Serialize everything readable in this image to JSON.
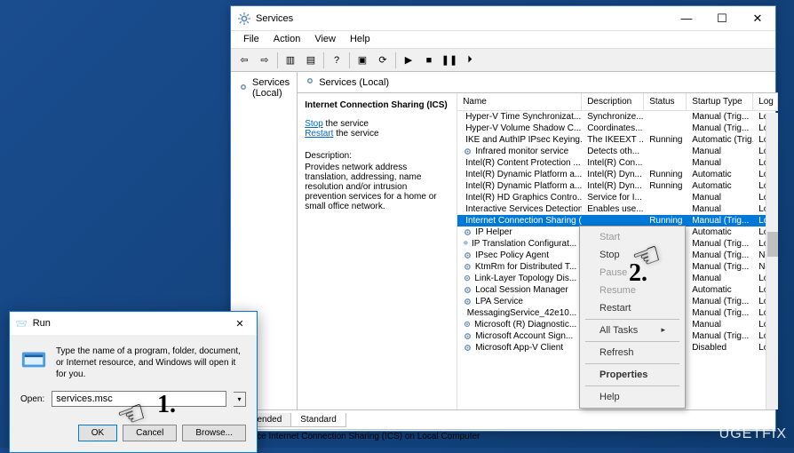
{
  "services_window": {
    "title": "Services",
    "menu": {
      "file": "File",
      "action": "Action",
      "view": "View",
      "help": "Help"
    },
    "left_panel": {
      "root": "Services (Local)"
    },
    "right_header": "Services (Local)",
    "selected_service": {
      "name": "Internet Connection Sharing (ICS)",
      "stop_link": "Stop",
      "stop_suffix": " the service",
      "restart_link": "Restart",
      "restart_suffix": " the service",
      "desc_label": "Description:",
      "desc_text": "Provides network address translation, addressing, name resolution and/or intrusion prevention services for a home or small office network."
    },
    "columns": {
      "name": "Name",
      "desc": "Description",
      "status": "Status",
      "startup": "Startup Type",
      "log": "Log"
    },
    "rows": [
      {
        "name": "Hyper-V Time Synchronizat...",
        "desc": "Synchronize...",
        "status": "",
        "startup": "Manual (Trig...",
        "log": "Loc"
      },
      {
        "name": "Hyper-V Volume Shadow C...",
        "desc": "Coordinates...",
        "status": "",
        "startup": "Manual (Trig...",
        "log": "Loc"
      },
      {
        "name": "IKE and AuthIP IPsec Keying...",
        "desc": "The IKEEXT ...",
        "status": "Running",
        "startup": "Automatic (Trig...",
        "log": "Loc"
      },
      {
        "name": "Infrared monitor service",
        "desc": "Detects oth...",
        "status": "",
        "startup": "Manual",
        "log": "Loc"
      },
      {
        "name": "Intel(R) Content Protection ...",
        "desc": "Intel(R) Con...",
        "status": "",
        "startup": "Manual",
        "log": "Loc"
      },
      {
        "name": "Intel(R) Dynamic Platform a...",
        "desc": "Intel(R) Dyn...",
        "status": "Running",
        "startup": "Automatic",
        "log": "Loc"
      },
      {
        "name": "Intel(R) Dynamic Platform a...",
        "desc": "Intel(R) Dyn...",
        "status": "Running",
        "startup": "Automatic",
        "log": "Loc"
      },
      {
        "name": "Intel(R) HD Graphics Contro...",
        "desc": "Service for I...",
        "status": "",
        "startup": "Manual",
        "log": "Loc"
      },
      {
        "name": "Interactive Services Detection",
        "desc": "Enables use...",
        "status": "",
        "startup": "Manual",
        "log": "Loc"
      },
      {
        "name": "Internet Connection Sharing (ICS)",
        "desc": "",
        "status": "Running",
        "startup": "Manual (Trig...",
        "log": "Loc",
        "selected": true
      },
      {
        "name": "IP Helper",
        "desc": "",
        "status": "",
        "startup": "Automatic",
        "log": "Loc"
      },
      {
        "name": "IP Translation Configurat...",
        "desc": "",
        "status": "",
        "startup": "Manual (Trig...",
        "log": "Loc"
      },
      {
        "name": "IPsec Policy Agent",
        "desc": "",
        "status": "",
        "startup": "Manual (Trig...",
        "log": "Net"
      },
      {
        "name": "KtmRm for Distributed T...",
        "desc": "",
        "status": "",
        "startup": "Manual (Trig...",
        "log": "Net"
      },
      {
        "name": "Link-Layer Topology Dis...",
        "desc": "",
        "status": "",
        "startup": "Manual",
        "log": "Loc"
      },
      {
        "name": "Local Session Manager",
        "desc": "",
        "status": "",
        "startup": "Automatic",
        "log": "Loc"
      },
      {
        "name": "LPA Service",
        "desc": "",
        "status": "",
        "startup": "Manual (Trig...",
        "log": "Loc"
      },
      {
        "name": "MessagingService_42e10...",
        "desc": "",
        "status": "",
        "startup": "Manual (Trig...",
        "log": "Loc"
      },
      {
        "name": "Microsoft (R) Diagnostic...",
        "desc": "",
        "status": "",
        "startup": "Manual",
        "log": "Loc"
      },
      {
        "name": "Microsoft Account Sign...",
        "desc": "",
        "status": "",
        "startup": "Manual (Trig...",
        "log": "Loc"
      },
      {
        "name": "Microsoft App-V Client",
        "desc": "",
        "status": "",
        "startup": "Disabled",
        "log": "Loc"
      }
    ],
    "tabs": {
      "extended": "Extended",
      "standard": "Standard"
    },
    "statusbar": "service Internet Connection Sharing (ICS) on Local Computer"
  },
  "context_menu": {
    "start": "Start",
    "stop": "Stop",
    "pause": "Pause",
    "resume": "Resume",
    "restart": "Restart",
    "all_tasks": "All Tasks",
    "refresh": "Refresh",
    "properties": "Properties",
    "help": "Help"
  },
  "run_dialog": {
    "title": "Run",
    "prompt": "Type the name of a program, folder, document, or Internet resource, and Windows will open it for you.",
    "open_label": "Open:",
    "input_value": "services.msc",
    "ok": "OK",
    "cancel": "Cancel",
    "browse": "Browse..."
  },
  "annotations": {
    "num1": "1.",
    "num2": "2."
  },
  "watermark": "UGETFIX"
}
